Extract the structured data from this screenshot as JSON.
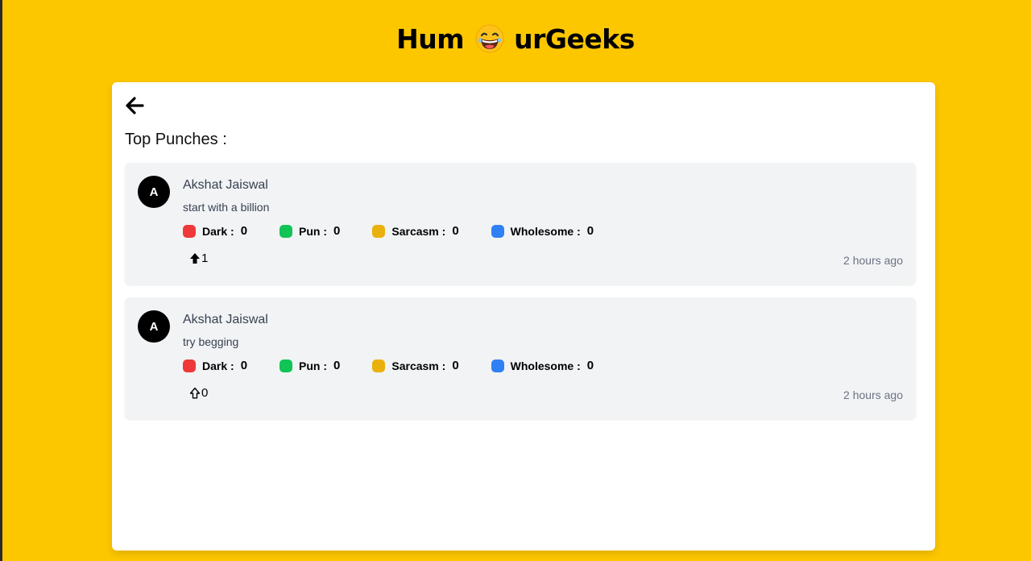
{
  "app": {
    "logo_left": "Hum",
    "logo_right": "urGeeks",
    "logo_emoji": "laughing-face-icon"
  },
  "page": {
    "section_title": "Top Punches :",
    "back_icon": "arrow-left-icon"
  },
  "colors": {
    "background": "#fdc700",
    "dark": "#ef3838",
    "pun": "#10c455",
    "sarcasm": "#eab10c",
    "wholesome": "#2f80f5"
  },
  "posts": [
    {
      "avatar_letter": "A",
      "author": "Akshat Jaiswal",
      "text": "start with a billion",
      "tags": [
        {
          "label": "Dark :",
          "count": "0"
        },
        {
          "label": "Pun :",
          "count": "0"
        },
        {
          "label": "Sarcasm :",
          "count": "0"
        },
        {
          "label": "Wholesome :",
          "count": "0"
        }
      ],
      "upvotes": "1",
      "upvoted": true,
      "time": "2 hours ago"
    },
    {
      "avatar_letter": "A",
      "author": "Akshat Jaiswal",
      "text": "try begging",
      "tags": [
        {
          "label": "Dark :",
          "count": "0"
        },
        {
          "label": "Pun :",
          "count": "0"
        },
        {
          "label": "Sarcasm :",
          "count": "0"
        },
        {
          "label": "Wholesome :",
          "count": "0"
        }
      ],
      "upvotes": "0",
      "upvoted": false,
      "time": "2 hours ago"
    }
  ]
}
